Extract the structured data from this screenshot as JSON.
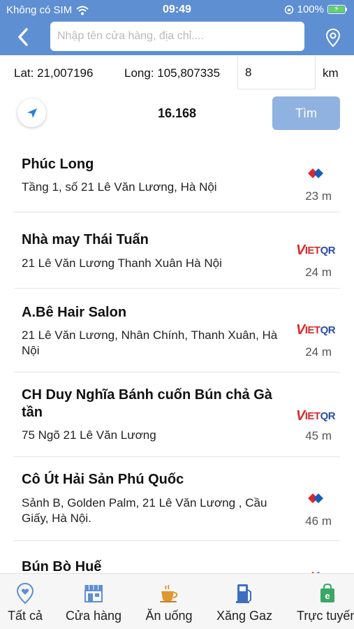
{
  "status_bar": {
    "carrier": "Không có SIM",
    "time": "09:49",
    "battery": "100%"
  },
  "search": {
    "placeholder": "Nhập tên cửa hàng, địa chỉ...."
  },
  "coords": {
    "lat": "Lat: 21,007196",
    "long": "Long: 105,807335",
    "radius": "8",
    "unit": "km"
  },
  "actions": {
    "count": "16.168",
    "find_label": "Tìm"
  },
  "stores": [
    {
      "name": "Phúc Long",
      "address": "Tầng 1, số 21 Lê Văn Lương, Hà Nội",
      "distance": "23 m",
      "logo": "vnpay"
    },
    {
      "name": "Nhà may Thái Tuấn",
      "address": "21 Lê Văn Lương Thanh Xuân Hà Nội",
      "distance": "24 m",
      "logo": "vietqr"
    },
    {
      "name": "A.Bê Hair Salon",
      "address": "21 Lê Văn Lương, Nhân Chính, Thanh Xuân, Hà Nội",
      "distance": "24 m",
      "logo": "vietqr"
    },
    {
      "name": "CH Duy Nghĩa Bánh cuốn Bún chả Gà tần",
      "address": "75 Ngõ 21 Lê Văn Lương",
      "distance": "45 m",
      "logo": "vietqr"
    },
    {
      "name": "Cô Út Hải Sản Phú Quốc",
      "address": "Sảnh B, Golden Palm, 21 Lê Văn Lương , Cầu Giấy, Hà Nội.",
      "distance": "46 m",
      "logo": "vnpay"
    },
    {
      "name": "Bún Bò Huế",
      "address": "",
      "distance": "",
      "logo": "vnpay"
    }
  ],
  "vietqr_logo": {
    "v": "V",
    "iet": "IET",
    "qr": "QR"
  },
  "tabs": [
    {
      "label": "Tất cả",
      "icon": "location-heart-icon"
    },
    {
      "label": "Cửa hàng",
      "icon": "store-icon"
    },
    {
      "label": "Ăn uống",
      "icon": "coffee-cup-icon"
    },
    {
      "label": "Xăng Gaz",
      "icon": "fuel-pump-icon"
    },
    {
      "label": "Trực tuyến",
      "icon": "shopping-bag-icon"
    }
  ],
  "colors": {
    "header": "#5e8fd3",
    "find_button": "#8fb2e0",
    "vnpay_red": "#e0262d",
    "vnpay_blue": "#1a5ab8",
    "locate_arrow": "#2b7de0"
  }
}
